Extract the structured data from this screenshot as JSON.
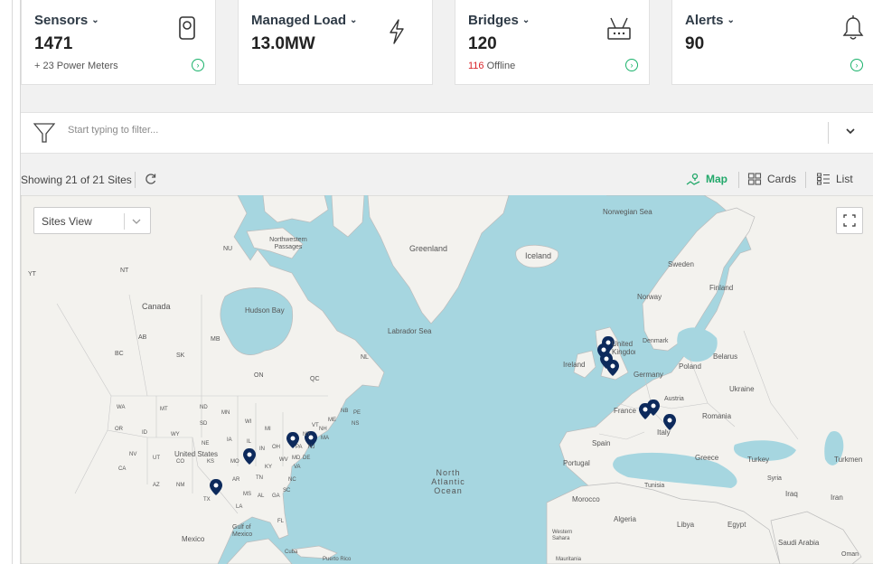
{
  "cards": [
    {
      "title": "Sensors",
      "value": "1471",
      "sub": "+ 23 Power Meters",
      "sub_red": "",
      "icon": "sensor-icon"
    },
    {
      "title": "Managed Load",
      "value": "13.0MW",
      "sub": "",
      "sub_red": "",
      "icon": "lightning-icon"
    },
    {
      "title": "Bridges",
      "value": "120",
      "sub": " Offline",
      "sub_red": "116",
      "icon": "router-icon"
    },
    {
      "title": "Alerts",
      "value": "90",
      "sub": "",
      "sub_red": "",
      "icon": "bell-icon"
    }
  ],
  "filter": {
    "placeholder": "Start typing to filter..."
  },
  "toolbar": {
    "showing": "Showing 21 of 21 Sites",
    "views": [
      {
        "label": "Map",
        "icon": "map-icon",
        "active": true
      },
      {
        "label": "Cards",
        "icon": "cards-icon",
        "active": false
      },
      {
        "label": "List",
        "icon": "list-icon",
        "active": false
      }
    ]
  },
  "map": {
    "view_select": "Sites View",
    "labels": {
      "norwegian_sea": "Norwegian Sea",
      "nw_passages": "Northwestern Passages",
      "greenland": "Greenland",
      "iceland": "Iceland",
      "yt": "YT",
      "nt": "NT",
      "nu": "NU",
      "canada": "Canada",
      "hudson_bay": "Hudson Bay",
      "labrador_sea": "Labrador Sea",
      "sweden": "Sweden",
      "finland": "Finland",
      "norway": "Norway",
      "bc": "BC",
      "ab": "AB",
      "sk": "SK",
      "mb": "MB",
      "on": "ON",
      "qc": "QC",
      "nl": "NL",
      "denmark": "Denmark",
      "ireland": "Ireland",
      "united_kingdom": "United Kingdom",
      "poland": "Poland",
      "belarus": "Belarus",
      "germany": "Germany",
      "ukraine": "Ukraine",
      "austria": "Austria",
      "france": "France",
      "romania": "Romania",
      "italy": "Italy",
      "spain": "Spain",
      "portugal": "Portugal",
      "greece": "Greece",
      "turkey": "Turkey",
      "turkmen": "Turkmen",
      "syria": "Syria",
      "iraq": "Iraq",
      "iran": "Iran",
      "tunisia": "Tunisia",
      "morocco": "Morocco",
      "algeria": "Algeria",
      "libya": "Libya",
      "egypt": "Egypt",
      "saudi": "Saudi Arabia",
      "oman": "Oman",
      "western_sahara": "Western Sahara",
      "mauritania": "Mauritania",
      "north_atlantic": "North Atlantic Ocean",
      "united_states": "United States",
      "gulf_mexico": "Gulf of Mexico",
      "mexico": "Mexico",
      "cuba": "Cuba",
      "puerto_rico": "Puerto Rico",
      "wa": "WA",
      "mt": "MT",
      "nd": "ND",
      "mn": "MN",
      "or": "OR",
      "id": "ID",
      "sd": "SD",
      "wy": "WY",
      "ne": "NE",
      "ia": "IA",
      "nv": "NV",
      "ut": "UT",
      "co": "CO",
      "ks": "KS",
      "mo": "MO",
      "ca": "CA",
      "az": "AZ",
      "nm": "NM",
      "tx": "TX",
      "ok": "OK",
      "ar": "AR",
      "la": "LA",
      "ms": "MS",
      "al": "AL",
      "ga": "GA",
      "fl": "FL",
      "tn": "TN",
      "ky": "KY",
      "in": "IN",
      "oh": "OH",
      "il": "IL",
      "wi": "WI",
      "mi": "MI",
      "pa": "PA",
      "ny": "NY",
      "va": "VA",
      "wv": "WV",
      "nc": "NC",
      "sc": "SC",
      "md": "MD",
      "de": "DE",
      "nj": "NJ",
      "vt": "VT",
      "nh": "NH",
      "me": "ME",
      "ma": "MA",
      "nb": "NB",
      "ns": "NS",
      "pe": "PE"
    },
    "pin_color": "#0d2a5c"
  },
  "colors": {
    "accent": "#22a86a",
    "alert": "#d9252b",
    "water": "#a6d6e0",
    "land": "#f3f2ee"
  }
}
